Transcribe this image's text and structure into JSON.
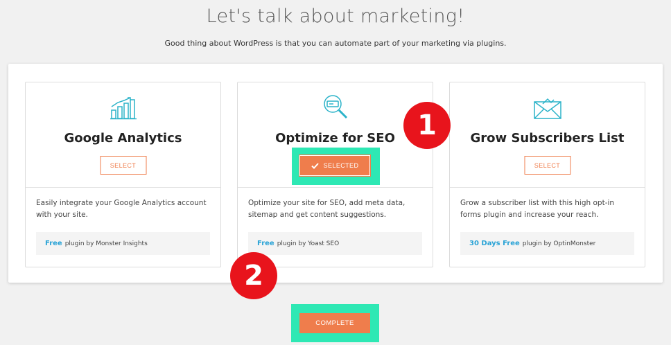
{
  "header": {
    "title": "Let's talk about marketing!",
    "subtitle": "Good thing about WordPress is that you can automate part of your marketing via plugins."
  },
  "cards": [
    {
      "icon": "bar-chart-icon",
      "title": "Google Analytics",
      "button_label": "SELECT",
      "selected": false,
      "description": "Easily integrate your Google Analytics account with your site.",
      "price": "Free",
      "plugin_text": "plugin by Monster Insights"
    },
    {
      "icon": "seo-magnifier-icon",
      "title": "Optimize for SEO",
      "button_label": "SELECTED",
      "selected": true,
      "description": "Optimize your site for SEO, add meta data, sitemap and get content suggestions.",
      "price": "Free",
      "plugin_text": "plugin by Yoast SEO"
    },
    {
      "icon": "envelope-icon",
      "title": "Grow Subscribers List",
      "button_label": "SELECT",
      "selected": false,
      "description": "Grow a subscriber list with this high opt-in forms plugin and increase your reach.",
      "price": "30 Days Free",
      "plugin_text": "plugin by OptinMonster"
    }
  ],
  "annotations": [
    {
      "label": "1"
    },
    {
      "label": "2"
    }
  ],
  "footer": {
    "complete_label": "COMPLETE"
  },
  "colors": {
    "accent": "#ef7d4c",
    "highlight": "#2ee8b4",
    "icon": "#2bb3c9",
    "price": "#2aa3d6",
    "badge": "#e8141c"
  }
}
